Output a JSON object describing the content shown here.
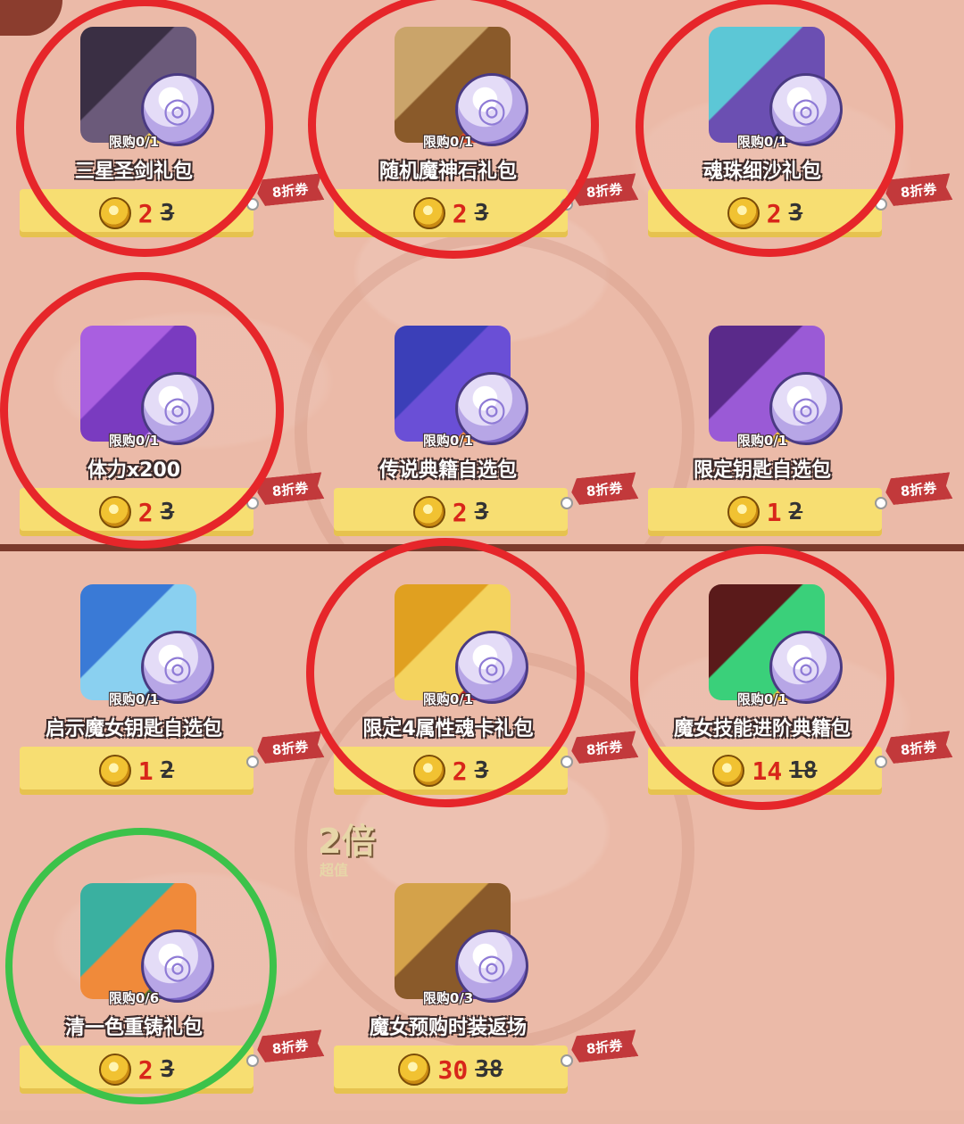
{
  "items": [
    {
      "name": "三星圣剑礼包",
      "limit": "限购0/1",
      "price": "2",
      "original": "3",
      "coupon": "8折券",
      "art": "black-ore-sword",
      "colors": [
        "#3a2f44",
        "#6b5a7a",
        "#f4d35e"
      ],
      "ring": "red"
    },
    {
      "name": "随机魔神石礼包",
      "limit": "限购0/1",
      "price": "2",
      "original": "3",
      "coupon": "8折券",
      "art": "demon-stone-pillar",
      "colors": [
        "#caa46a",
        "#8a5a2a",
        "#d84a2a"
      ],
      "ring": "red"
    },
    {
      "name": "魂珠细沙礼包",
      "limit": "限购0/1",
      "price": "2",
      "original": "3",
      "coupon": "8折券",
      "art": "sand-bottle",
      "colors": [
        "#5cc7d6",
        "#6b4fb2",
        "#2a2a6a"
      ],
      "ring": "red"
    },
    {
      "name": "体力x200",
      "limit": "限购0/1",
      "price": "2",
      "original": "3",
      "coupon": "8折券",
      "art": "purple-gift-box",
      "colors": [
        "#a95fe0",
        "#7a3bc0",
        "#d19cf5"
      ],
      "ring": "red"
    },
    {
      "name": "传说典籍自选包",
      "limit": "限购0/1",
      "price": "2",
      "original": "3",
      "coupon": "8折券",
      "art": "legend-book",
      "colors": [
        "#3b3fb8",
        "#6a4fd6",
        "#f08a3a"
      ],
      "ring": "none"
    },
    {
      "name": "限定钥匙自选包",
      "limit": "限购0/1",
      "price": "1",
      "original": "2",
      "coupon": "8折券",
      "art": "key-chest",
      "colors": [
        "#5a2a8a",
        "#9a5ad6",
        "#f4c33a"
      ],
      "ring": "none"
    },
    {
      "name": "启示魔女钥匙自选包",
      "limit": "限购0/1",
      "price": "1",
      "original": "2",
      "coupon": "8折券",
      "art": "crystal-orb",
      "colors": [
        "#3a7ad6",
        "#8ad0f0",
        "#2a3a6a"
      ],
      "ring": "none"
    },
    {
      "name": "限定4属性魂卡礼包",
      "limit": "限购0/1",
      "price": "2",
      "original": "3",
      "coupon": "8折券",
      "art": "gold-card",
      "colors": [
        "#e0a020",
        "#f4d35e",
        "#b4202a"
      ],
      "ring": "red"
    },
    {
      "name": "魔女技能进阶典籍包",
      "limit": "限购0/1",
      "price": "14",
      "original": "18",
      "coupon": "8折券",
      "art": "rainbow-gem-book",
      "colors": [
        "#5a1a1a",
        "#3ad07a",
        "#f0c040"
      ],
      "ring": "red"
    },
    {
      "name": "清一色重铸礼包",
      "limit": "限购0/6",
      "price": "2",
      "original": "3",
      "coupon": "8折券",
      "art": "rainbow-gems",
      "colors": [
        "#3ab0a0",
        "#f08a3a",
        "#4a7a2a"
      ],
      "ring": "green"
    },
    {
      "name": "魔女预购时装返场",
      "limit": "限购0/3",
      "price": "30",
      "original": "38",
      "coupon": "8折券",
      "art": "golden-chest",
      "colors": [
        "#d4a24a",
        "#8a5a2a",
        "#6a3ab0"
      ],
      "ring": "none"
    }
  ],
  "badge": {
    "main": "2倍",
    "sub": "超值"
  },
  "coin_glyph": "◎"
}
